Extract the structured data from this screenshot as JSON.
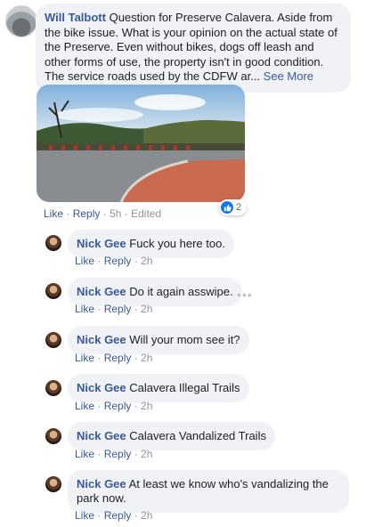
{
  "main_comment": {
    "author": "Will Talbott",
    "text": "Question for Preserve Calavera. Aside from the bike issue. What is your opinion on the actual state of the Preserve. Even without bikes, dogs off leash and other forms of use, the property isn't in good condition. The service roads used by the CDFW ar...",
    "see_more": "See More",
    "actions": {
      "like": "Like",
      "reply": "Reply",
      "time": "5h",
      "edited": "Edited"
    },
    "reaction_count": "2",
    "reaction_icon": "like-icon"
  },
  "replies": [
    {
      "author": "Nick Gee",
      "text": "Fuck you here too.",
      "like": "Like",
      "reply": "Reply",
      "time": "2h"
    },
    {
      "author": "Nick Gee",
      "text": "Do it again asswipe.",
      "like": "Like",
      "reply": "Reply",
      "time": "2h"
    },
    {
      "author": "Nick Gee",
      "text": "Will your mom see it?",
      "like": "Like",
      "reply": "Reply",
      "time": "2h"
    },
    {
      "author": "Nick Gee",
      "text": "Calavera Illegal Trails",
      "like": "Like",
      "reply": "Reply",
      "time": "2h"
    },
    {
      "author": "Nick Gee",
      "text": "Calavera Vandalized Trails",
      "like": "Like",
      "reply": "Reply",
      "time": "2h"
    },
    {
      "author": "Nick Gee",
      "text": "At least we know who's vandalizing the park now.",
      "like": "Like",
      "reply": "Reply",
      "time": "2h"
    }
  ],
  "colors": {
    "link": "#385898",
    "bubble": "#f0f2f5",
    "muted": "#90949c",
    "like_blue": "#1877f2"
  }
}
